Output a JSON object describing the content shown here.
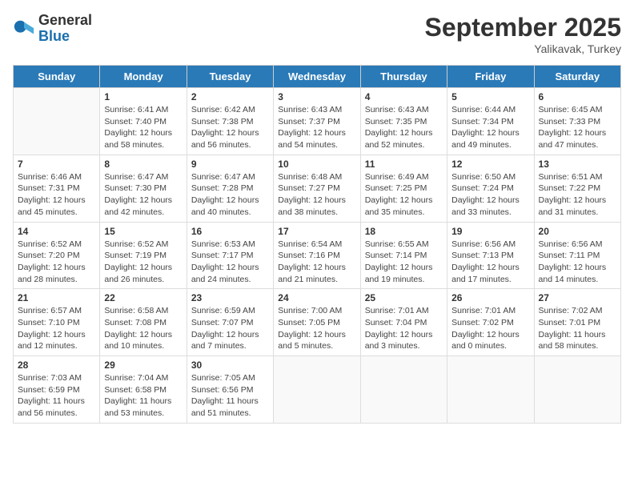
{
  "header": {
    "logo_general": "General",
    "logo_blue": "Blue",
    "month_title": "September 2025",
    "location": "Yalikavak, Turkey"
  },
  "weekdays": [
    "Sunday",
    "Monday",
    "Tuesday",
    "Wednesday",
    "Thursday",
    "Friday",
    "Saturday"
  ],
  "weeks": [
    [
      {
        "day": "",
        "info": ""
      },
      {
        "day": "1",
        "info": "Sunrise: 6:41 AM\nSunset: 7:40 PM\nDaylight: 12 hours\nand 58 minutes."
      },
      {
        "day": "2",
        "info": "Sunrise: 6:42 AM\nSunset: 7:38 PM\nDaylight: 12 hours\nand 56 minutes."
      },
      {
        "day": "3",
        "info": "Sunrise: 6:43 AM\nSunset: 7:37 PM\nDaylight: 12 hours\nand 54 minutes."
      },
      {
        "day": "4",
        "info": "Sunrise: 6:43 AM\nSunset: 7:35 PM\nDaylight: 12 hours\nand 52 minutes."
      },
      {
        "day": "5",
        "info": "Sunrise: 6:44 AM\nSunset: 7:34 PM\nDaylight: 12 hours\nand 49 minutes."
      },
      {
        "day": "6",
        "info": "Sunrise: 6:45 AM\nSunset: 7:33 PM\nDaylight: 12 hours\nand 47 minutes."
      }
    ],
    [
      {
        "day": "7",
        "info": "Sunrise: 6:46 AM\nSunset: 7:31 PM\nDaylight: 12 hours\nand 45 minutes."
      },
      {
        "day": "8",
        "info": "Sunrise: 6:47 AM\nSunset: 7:30 PM\nDaylight: 12 hours\nand 42 minutes."
      },
      {
        "day": "9",
        "info": "Sunrise: 6:47 AM\nSunset: 7:28 PM\nDaylight: 12 hours\nand 40 minutes."
      },
      {
        "day": "10",
        "info": "Sunrise: 6:48 AM\nSunset: 7:27 PM\nDaylight: 12 hours\nand 38 minutes."
      },
      {
        "day": "11",
        "info": "Sunrise: 6:49 AM\nSunset: 7:25 PM\nDaylight: 12 hours\nand 35 minutes."
      },
      {
        "day": "12",
        "info": "Sunrise: 6:50 AM\nSunset: 7:24 PM\nDaylight: 12 hours\nand 33 minutes."
      },
      {
        "day": "13",
        "info": "Sunrise: 6:51 AM\nSunset: 7:22 PM\nDaylight: 12 hours\nand 31 minutes."
      }
    ],
    [
      {
        "day": "14",
        "info": "Sunrise: 6:52 AM\nSunset: 7:20 PM\nDaylight: 12 hours\nand 28 minutes."
      },
      {
        "day": "15",
        "info": "Sunrise: 6:52 AM\nSunset: 7:19 PM\nDaylight: 12 hours\nand 26 minutes."
      },
      {
        "day": "16",
        "info": "Sunrise: 6:53 AM\nSunset: 7:17 PM\nDaylight: 12 hours\nand 24 minutes."
      },
      {
        "day": "17",
        "info": "Sunrise: 6:54 AM\nSunset: 7:16 PM\nDaylight: 12 hours\nand 21 minutes."
      },
      {
        "day": "18",
        "info": "Sunrise: 6:55 AM\nSunset: 7:14 PM\nDaylight: 12 hours\nand 19 minutes."
      },
      {
        "day": "19",
        "info": "Sunrise: 6:56 AM\nSunset: 7:13 PM\nDaylight: 12 hours\nand 17 minutes."
      },
      {
        "day": "20",
        "info": "Sunrise: 6:56 AM\nSunset: 7:11 PM\nDaylight: 12 hours\nand 14 minutes."
      }
    ],
    [
      {
        "day": "21",
        "info": "Sunrise: 6:57 AM\nSunset: 7:10 PM\nDaylight: 12 hours\nand 12 minutes."
      },
      {
        "day": "22",
        "info": "Sunrise: 6:58 AM\nSunset: 7:08 PM\nDaylight: 12 hours\nand 10 minutes."
      },
      {
        "day": "23",
        "info": "Sunrise: 6:59 AM\nSunset: 7:07 PM\nDaylight: 12 hours\nand 7 minutes."
      },
      {
        "day": "24",
        "info": "Sunrise: 7:00 AM\nSunset: 7:05 PM\nDaylight: 12 hours\nand 5 minutes."
      },
      {
        "day": "25",
        "info": "Sunrise: 7:01 AM\nSunset: 7:04 PM\nDaylight: 12 hours\nand 3 minutes."
      },
      {
        "day": "26",
        "info": "Sunrise: 7:01 AM\nSunset: 7:02 PM\nDaylight: 12 hours\nand 0 minutes."
      },
      {
        "day": "27",
        "info": "Sunrise: 7:02 AM\nSunset: 7:01 PM\nDaylight: 11 hours\nand 58 minutes."
      }
    ],
    [
      {
        "day": "28",
        "info": "Sunrise: 7:03 AM\nSunset: 6:59 PM\nDaylight: 11 hours\nand 56 minutes."
      },
      {
        "day": "29",
        "info": "Sunrise: 7:04 AM\nSunset: 6:58 PM\nDaylight: 11 hours\nand 53 minutes."
      },
      {
        "day": "30",
        "info": "Sunrise: 7:05 AM\nSunset: 6:56 PM\nDaylight: 11 hours\nand 51 minutes."
      },
      {
        "day": "",
        "info": ""
      },
      {
        "day": "",
        "info": ""
      },
      {
        "day": "",
        "info": ""
      },
      {
        "day": "",
        "info": ""
      }
    ]
  ]
}
